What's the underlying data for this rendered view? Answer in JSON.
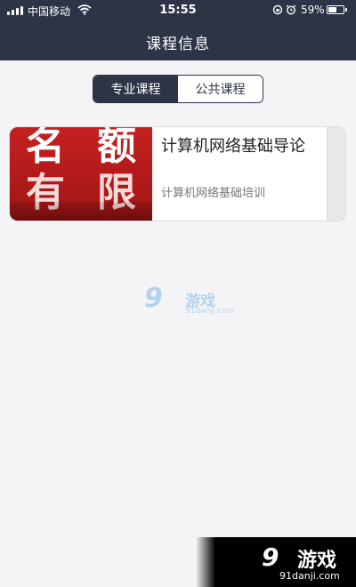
{
  "status_bar": {
    "carrier": "中国移动",
    "time": "15:55",
    "battery_text": "59%",
    "battery_level": 0.59,
    "icons": [
      "signal-icon",
      "wifi-icon",
      "rotation-lock-icon",
      "alarm-icon",
      "battery-icon"
    ]
  },
  "header": {
    "title": "课程信息"
  },
  "tabs": [
    {
      "label": "专业课程",
      "selected": true
    },
    {
      "label": "公共课程",
      "selected": false
    }
  ],
  "courses": [
    {
      "thumbnail_text": [
        "名",
        "额",
        "有",
        "限"
      ],
      "title": "计算机网络基础导论",
      "subtitle": "计算机网络基础培训"
    }
  ],
  "watermarks": {
    "center": {
      "mark": "9",
      "name": "游戏",
      "url": "91danji.com"
    },
    "corner": {
      "mark": "9",
      "name": "游戏",
      "url": "91danji.com"
    }
  },
  "colors": {
    "header_bg": "#2c3446",
    "page_bg": "#f4f4f6",
    "thumbnail_red": "#c62121"
  }
}
